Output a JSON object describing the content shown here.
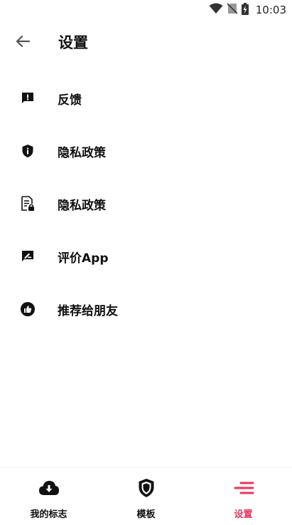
{
  "status_bar": {
    "time": "10:03",
    "icons": [
      "wifi-icon",
      "no-sim-icon",
      "battery-charging-icon"
    ]
  },
  "app_bar": {
    "title": "设置",
    "back_icon": "arrow-left-icon"
  },
  "menu": {
    "items": [
      {
        "label": "反馈",
        "icon": "feedback-icon"
      },
      {
        "label": "隐私政策",
        "icon": "shield-icon"
      },
      {
        "label": "隐私政策",
        "icon": "document-lock-icon"
      },
      {
        "label": "评价App",
        "icon": "rate-review-icon"
      },
      {
        "label": "推荐给朋友",
        "icon": "thumb-up-icon"
      }
    ]
  },
  "bottom_nav": {
    "items": [
      {
        "label": "我的标志",
        "icon": "cloud-download-icon",
        "active": false
      },
      {
        "label": "模板",
        "icon": "shield-badge-icon",
        "active": false
      },
      {
        "label": "设置",
        "icon": "menu-lines-icon",
        "active": true
      }
    ],
    "active_color": "#e8365d",
    "text_color": "#111111"
  }
}
